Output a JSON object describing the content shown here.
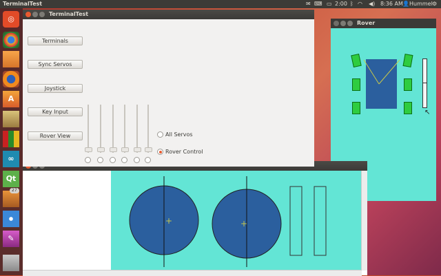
{
  "top_panel": {
    "title": "TerminalTest",
    "battery": "2:00",
    "time": "8:36 AM",
    "user": "Hummel"
  },
  "launcher": {
    "items": [
      "ubuntu-home",
      "chromium",
      "files",
      "firefox",
      "software-center",
      "system",
      "libreoffice",
      "arduino",
      "qt-creator",
      "updates",
      "inkscape",
      "font-viewer",
      "usb-drive"
    ],
    "updates_badge": "27"
  },
  "terminal_test_window": {
    "title": "TerminalTest",
    "buttons": [
      "Terminals",
      "Sync Servos",
      "Joystick",
      "Key Input",
      "Rover View"
    ],
    "servo_slider_count": 6,
    "radio_options": [
      {
        "label": "All Servos",
        "selected": false
      },
      {
        "label": "Rover Control",
        "selected": true
      }
    ]
  },
  "rover_window": {
    "title": "Rover",
    "colors": {
      "background": "#63e5d5",
      "body": "#2b5f9e",
      "wheel": "#2ecc40"
    }
  },
  "view_window": {
    "colors": {
      "background": "#63e5d5",
      "circle": "#2b5f9e"
    }
  }
}
